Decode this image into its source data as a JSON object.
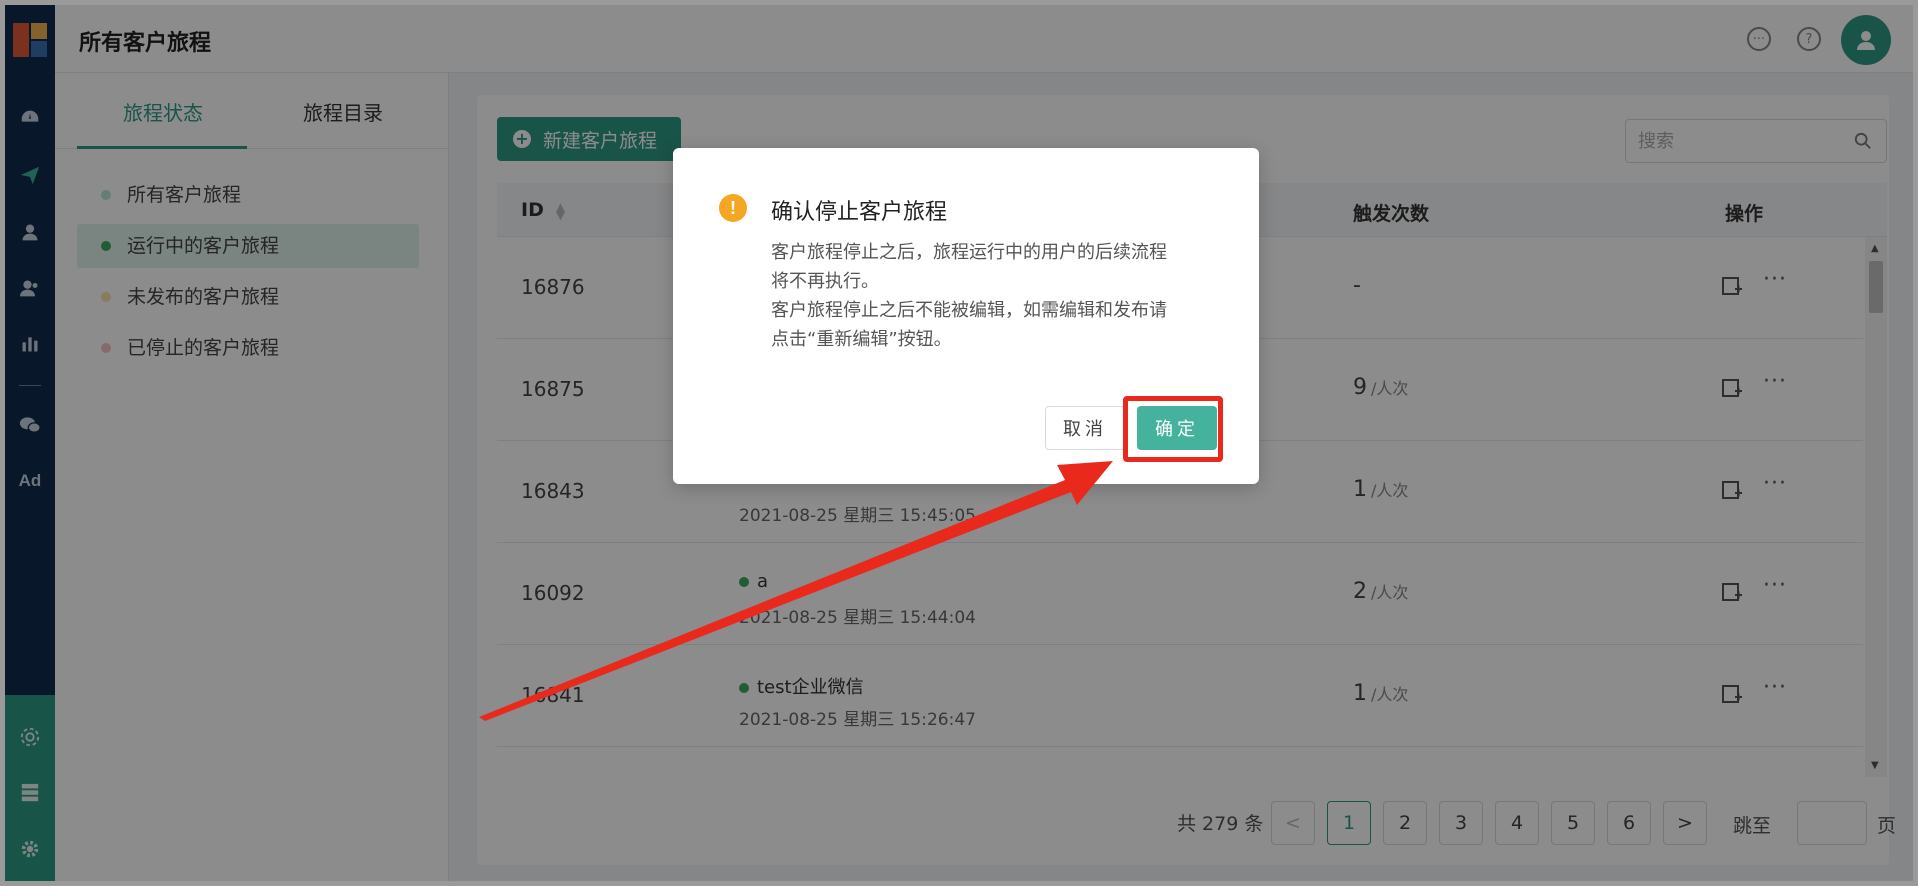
{
  "header": {
    "title": "所有客户旅程"
  },
  "rail": {
    "items": [
      {
        "icon": "dashboard-icon",
        "active": false
      },
      {
        "icon": "send-icon",
        "active": true
      },
      {
        "icon": "user-icon",
        "active": false
      },
      {
        "icon": "users-icon",
        "active": false
      },
      {
        "icon": "bar-chart-icon",
        "active": false
      },
      {
        "icon": "wechat-icon",
        "active": false
      }
    ],
    "ad_label": "Ad"
  },
  "left_panel": {
    "tabs": [
      {
        "label": "旅程状态",
        "active": true
      },
      {
        "label": "旅程目录",
        "active": false
      }
    ],
    "nav_items": [
      {
        "label": "所有客户旅程",
        "dot_color": "#b7e3d6",
        "active": false
      },
      {
        "label": "运行中的客户旅程",
        "dot_color": "#3da861",
        "active": true
      },
      {
        "label": "未发布的客户旅程",
        "dot_color": "#f7e2a8",
        "active": false
      },
      {
        "label": "已停止的客户旅程",
        "dot_color": "#f3c3c3",
        "active": false
      }
    ]
  },
  "toolbar": {
    "new_button_label": "新建客户旅程",
    "search_placeholder": "搜索"
  },
  "table": {
    "columns": {
      "id": "ID",
      "count": "触发次数",
      "actions": "操作"
    },
    "count_unit": "/人次",
    "rows": [
      {
        "id": "16876",
        "name": "",
        "time": "",
        "count": "-"
      },
      {
        "id": "16875",
        "name": "",
        "time": "",
        "count": "9"
      },
      {
        "id": "16843",
        "name": "",
        "time": "2021-08-25 星期三 15:45:05",
        "count": "1"
      },
      {
        "id": "16092",
        "name": "a",
        "time": "2021-08-25 星期三 15:44:04",
        "count": "2"
      },
      {
        "id": "16841",
        "name": "test企业微信",
        "time": "2021-08-25 星期三 15:26:47",
        "count": "1"
      }
    ]
  },
  "pagination": {
    "total_label": "共 279 条",
    "prev": "<",
    "next": ">",
    "pages": [
      "1",
      "2",
      "3",
      "4",
      "5",
      "6"
    ],
    "current": "1",
    "jump_label": "跳至",
    "page_suffix": "页"
  },
  "modal": {
    "title": "确认停止客户旅程",
    "body_lines": [
      "客户旅程停止之后，旅程运行中的用户的后续流程",
      "将不再执行。",
      "客户旅程停止之后不能被编辑，如需编辑和发布请",
      "点击“重新编辑”按钮。"
    ],
    "cancel_label": "取消",
    "ok_label": "确定"
  },
  "colors": {
    "brand": "#2f9a86",
    "rail_bg": "#0f2a4d",
    "highlight": "#e8291c",
    "warning": "#f5a623"
  }
}
